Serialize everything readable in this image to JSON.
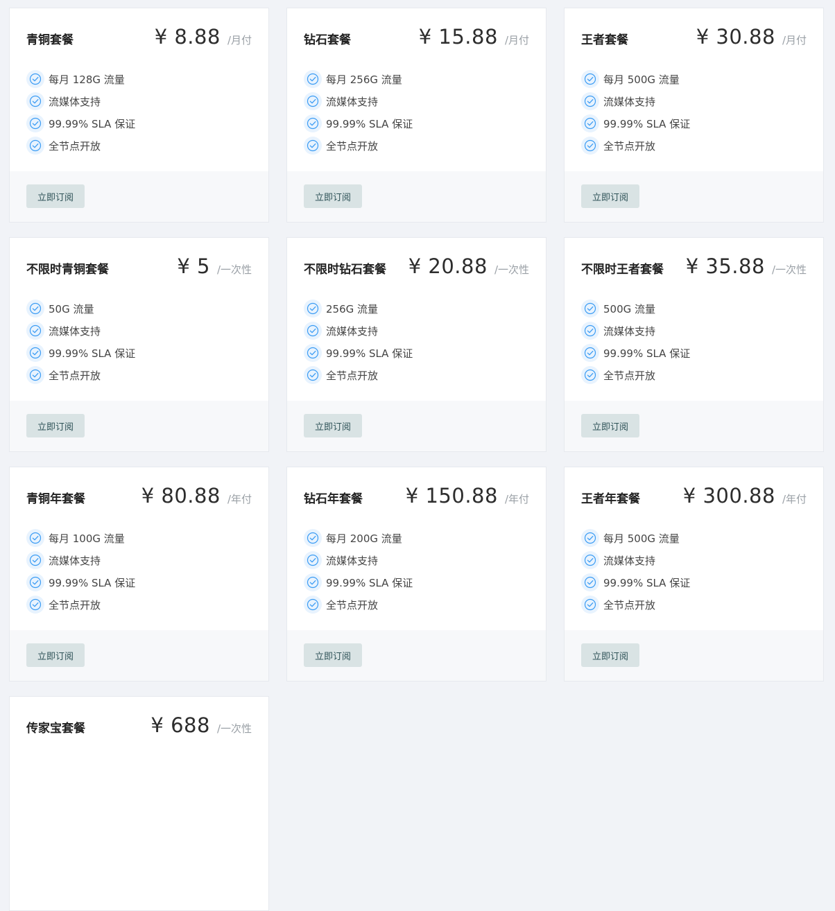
{
  "plans": [
    {
      "name": "青铜套餐",
      "price": "¥ 8.88",
      "period": "/月付",
      "features": [
        "每月 128G 流量",
        "流媒体支持",
        "99.99% SLA 保证",
        "全节点开放"
      ],
      "button": "立即订阅"
    },
    {
      "name": "钻石套餐",
      "price": "¥ 15.88",
      "period": "/月付",
      "features": [
        "每月 256G 流量",
        "流媒体支持",
        "99.99% SLA 保证",
        "全节点开放"
      ],
      "button": "立即订阅"
    },
    {
      "name": "王者套餐",
      "price": "¥ 30.88",
      "period": "/月付",
      "features": [
        "每月 500G 流量",
        "流媒体支持",
        "99.99% SLA 保证",
        "全节点开放"
      ],
      "button": "立即订阅"
    },
    {
      "name": "不限时青铜套餐",
      "price": "¥ 5",
      "period": "/一次性",
      "features": [
        "50G 流量",
        "流媒体支持",
        "99.99% SLA 保证",
        "全节点开放"
      ],
      "button": "立即订阅"
    },
    {
      "name": "不限时钻石套餐",
      "price": "¥ 20.88",
      "period": "/一次性",
      "features": [
        "256G 流量",
        "流媒体支持",
        "99.99% SLA 保证",
        "全节点开放"
      ],
      "button": "立即订阅"
    },
    {
      "name": "不限时王者套餐",
      "price": "¥ 35.88",
      "period": "/一次性",
      "features": [
        "500G 流量",
        "流媒体支持",
        "99.99% SLA 保证",
        "全节点开放"
      ],
      "button": "立即订阅"
    },
    {
      "name": "青铜年套餐",
      "price": "¥ 80.88",
      "period": "/年付",
      "features": [
        "每月 100G 流量",
        "流媒体支持",
        "99.99% SLA 保证",
        "全节点开放"
      ],
      "button": "立即订阅"
    },
    {
      "name": "钻石年套餐",
      "price": "¥ 150.88",
      "period": "/年付",
      "features": [
        "每月 200G 流量",
        "流媒体支持",
        "99.99% SLA 保证",
        "全节点开放"
      ],
      "button": "立即订阅"
    },
    {
      "name": "王者年套餐",
      "price": "¥ 300.88",
      "period": "/年付",
      "features": [
        "每月 500G 流量",
        "流媒体支持",
        "99.99% SLA 保证",
        "全节点开放"
      ],
      "button": "立即订阅"
    },
    {
      "name": "传家宝套餐",
      "price": "¥ 688",
      "period": "/一次性",
      "features": [],
      "button": ""
    }
  ],
  "icon": {
    "feature": "check-circle-icon"
  },
  "colors": {
    "page_bg": "#f1f3f7",
    "check_icon": "#3b9cf4",
    "check_icon_bg": "#e8f3fe",
    "button_bg": "#d9e3e4",
    "button_text": "#2e5257"
  }
}
